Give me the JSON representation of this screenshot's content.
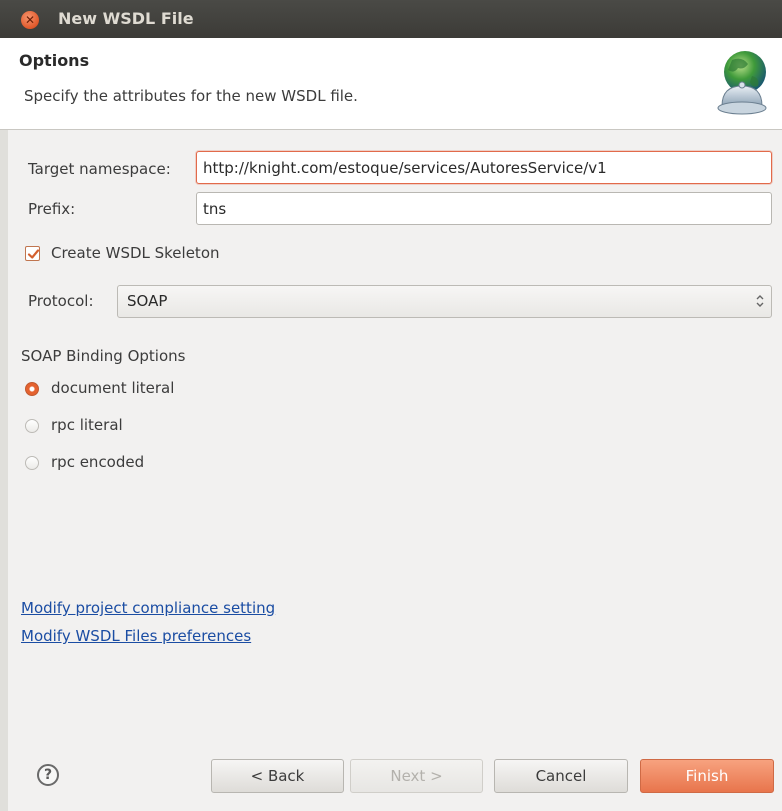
{
  "window": {
    "title": "New WSDL File"
  },
  "header": {
    "title": "Options",
    "description": "Specify the attributes for the new WSDL file."
  },
  "form": {
    "target_namespace_label": "Target namespace:",
    "target_namespace_value": "http://knight.com/estoque/services/AutoresService/v1",
    "prefix_label": "Prefix:",
    "prefix_value": "tns",
    "create_skeleton_label": "Create WSDL Skeleton",
    "create_skeleton_checked": true,
    "protocol_label": "Protocol:",
    "protocol_value": "SOAP"
  },
  "binding": {
    "group_label": "SOAP Binding Options",
    "options": [
      {
        "label": "document literal",
        "selected": true
      },
      {
        "label": "rpc literal",
        "selected": false
      },
      {
        "label": "rpc encoded",
        "selected": false
      }
    ]
  },
  "links": {
    "compliance": "Modify project compliance setting",
    "preferences": "Modify WSDL Files preferences"
  },
  "buttons": {
    "help": "?",
    "back": "< Back",
    "next": "Next >",
    "cancel": "Cancel",
    "finish": "Finish"
  },
  "colors": {
    "accent": "#e8754c",
    "link": "#1b4da3",
    "titlebar": "#3c3b37"
  }
}
